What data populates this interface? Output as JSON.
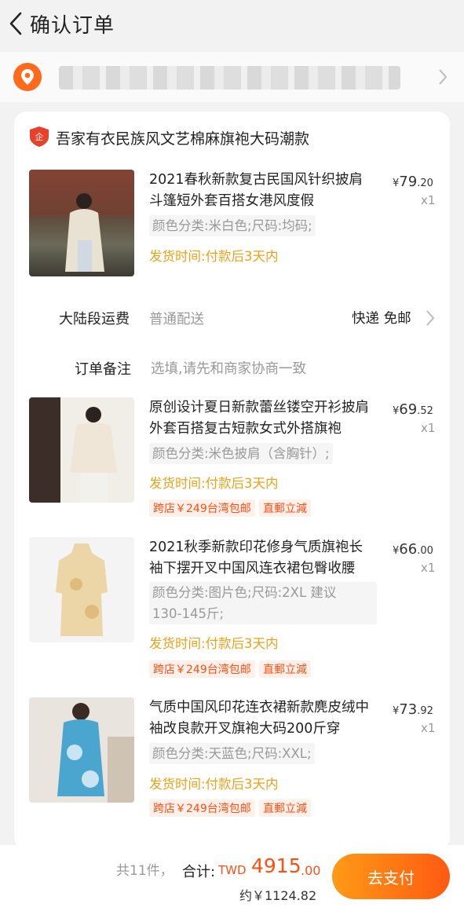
{
  "header": {
    "title": "确认订单"
  },
  "address": {
    "placeholder_blurred": true
  },
  "shop": {
    "name": "吾家有衣民族风文艺棉麻旗袍大码潮款",
    "logo_text": "企"
  },
  "items": [
    {
      "title_line1": "2021春秋新款复古民国风针织披肩",
      "title_line2": "斗篷短外套百搭女港风度假",
      "price_symbol": "¥",
      "price_int": "79",
      "price_dec": ".20",
      "qty": "x1",
      "spec_line1": "颜色分类:米白色;尺码:均码;",
      "ship": "发货时间:付款后3天内"
    },
    {
      "title_line1": "原创设计夏日新款蕾丝镂空开衫披肩",
      "title_line2": "外套百搭复古短款女式外搭旗袍",
      "price_symbol": "¥",
      "price_int": "69",
      "price_dec": ".52",
      "qty": "x1",
      "spec_line1": "颜色分类:米色披肩（含胸针）;",
      "ship": "发货时间:付款后3天内",
      "tag1": "跨店￥249台湾包邮",
      "tag2": "直郵立減"
    },
    {
      "title_line1": "2021秋季新款印花修身气质旗袍长",
      "title_line2": "袖下摆开叉中国风连衣裙包臀收腰",
      "price_symbol": "¥",
      "price_int": "66",
      "price_dec": ".00",
      "qty": "x1",
      "spec_line1": "颜色分类:图片色;尺码:2XL 建议",
      "spec_line2": "130-145斤;",
      "ship": "发货时间:付款后3天内",
      "tag1": "跨店￥249台湾包邮",
      "tag2": "直郵立減"
    },
    {
      "title_line1": "气质中国风印花连衣裙新款麂皮绒中",
      "title_line2": "袖改良款开叉旗袍大码200斤穿",
      "price_symbol": "¥",
      "price_int": "73",
      "price_dec": ".92",
      "qty": "x1",
      "spec_line1": "颜色分类:天蓝色;尺码:XXL;",
      "ship": "发货时间:付款后3天内",
      "tag1": "跨店￥249台湾包邮",
      "tag2": "直郵立減"
    }
  ],
  "shipping_row": {
    "label": "大陆段运费",
    "method": "普通配送",
    "value": "快递 免邮"
  },
  "note_row": {
    "label": "订单备注",
    "placeholder": "选填,请先和商家协商一致"
  },
  "footer": {
    "count": "共11件，",
    "total_label": "合计:",
    "currency": "TWD",
    "amount_int": "4915",
    "amount_dec": ".00",
    "approx": "约￥1124.82",
    "pay_button": "去支付"
  },
  "colors": {
    "accent": "#ff4f15",
    "ship_text": "#e9a21a",
    "pay_start": "#ff9a16",
    "pay_end": "#ff5a11"
  },
  "icons": [
    "back-arrow-icon",
    "location-pin-icon",
    "chevron-right-icon",
    "shop-badge-icon"
  ]
}
